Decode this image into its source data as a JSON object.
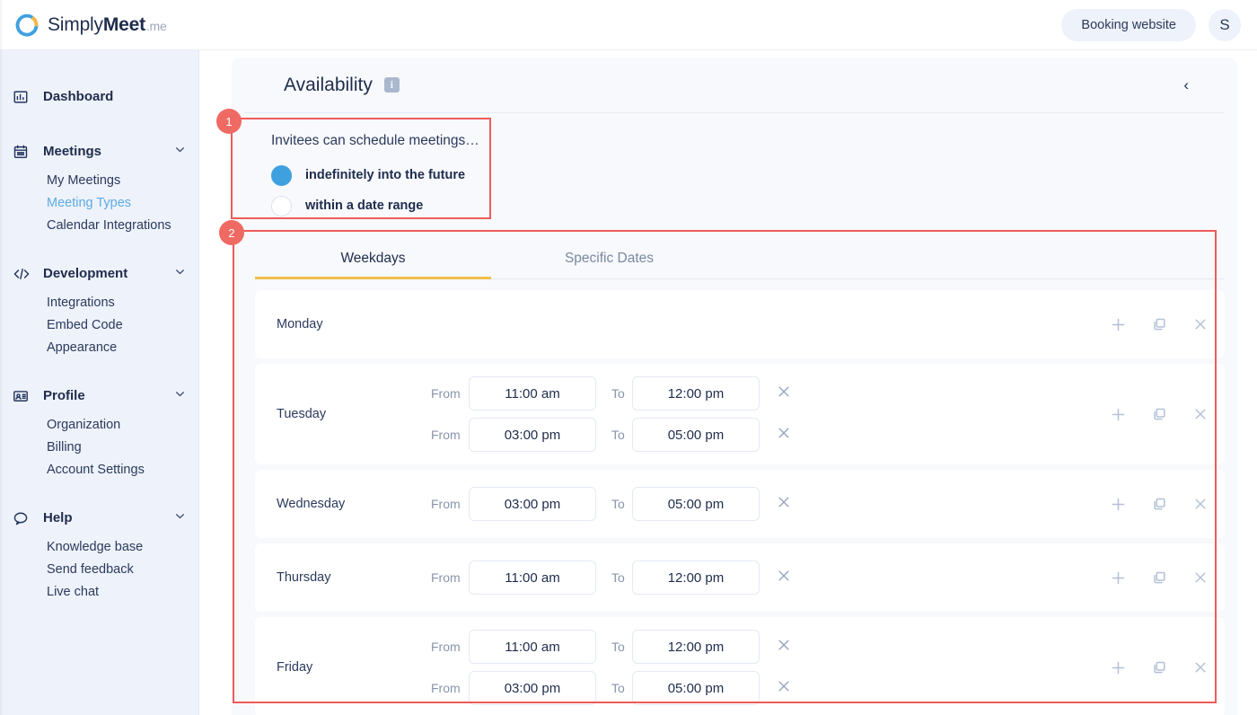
{
  "brand": {
    "name_light": "Simply",
    "name_bold": "Meet",
    "suffix": ".me",
    "logo_icon": "simplymeet-ring-logo"
  },
  "topbar": {
    "booking_button": "Booking website",
    "avatar_initial": "S"
  },
  "sidebar": {
    "groups": [
      {
        "icon": "chart-bar-icon",
        "label": "Dashboard",
        "has_chevron": false,
        "items": []
      },
      {
        "icon": "calendar-icon",
        "label": "Meetings",
        "has_chevron": true,
        "items": [
          {
            "label": "My Meetings",
            "active": false
          },
          {
            "label": "Meeting Types",
            "active": true
          },
          {
            "label": "Calendar Integrations",
            "active": false
          }
        ]
      },
      {
        "icon": "code-icon",
        "label": "Development",
        "has_chevron": true,
        "items": [
          {
            "label": "Integrations",
            "active": false
          },
          {
            "label": "Embed Code",
            "active": false
          },
          {
            "label": "Appearance",
            "active": false
          }
        ]
      },
      {
        "icon": "id-card-icon",
        "label": "Profile",
        "has_chevron": true,
        "items": [
          {
            "label": "Organization",
            "active": false
          },
          {
            "label": "Billing",
            "active": false
          },
          {
            "label": "Account Settings",
            "active": false
          }
        ]
      },
      {
        "icon": "chat-bubble-icon",
        "label": "Help",
        "has_chevron": true,
        "items": [
          {
            "label": "Knowledge base",
            "active": false
          },
          {
            "label": "Send feedback",
            "active": false
          },
          {
            "label": "Live chat",
            "active": false
          }
        ]
      }
    ]
  },
  "availability": {
    "title": "Availability",
    "info_icon": "info-icon",
    "collapse_icon": "chevron-left-icon",
    "schedule_window": {
      "title": "Invitees can schedule meetings…",
      "options": [
        {
          "label": "indefinitely into the future",
          "selected": true
        },
        {
          "label": "within a date range",
          "selected": false
        }
      ]
    },
    "tabs": [
      {
        "label": "Weekdays",
        "active": true
      },
      {
        "label": "Specific Dates",
        "active": false
      }
    ],
    "labels": {
      "from": "From",
      "to": "To"
    },
    "row_action_icons": [
      "plus-icon",
      "copy-icon",
      "close-icon"
    ],
    "days": [
      {
        "name": "Monday",
        "slots": []
      },
      {
        "name": "Tuesday",
        "slots": [
          {
            "from": "11:00 am",
            "to": "12:00 pm"
          },
          {
            "from": "03:00 pm",
            "to": "05:00 pm"
          }
        ]
      },
      {
        "name": "Wednesday",
        "slots": [
          {
            "from": "03:00 pm",
            "to": "05:00 pm"
          }
        ]
      },
      {
        "name": "Thursday",
        "slots": [
          {
            "from": "11:00 am",
            "to": "12:00 pm"
          }
        ]
      },
      {
        "name": "Friday",
        "slots": [
          {
            "from": "11:00 am",
            "to": "12:00 pm"
          },
          {
            "from": "03:00 pm",
            "to": "05:00 pm"
          }
        ]
      }
    ]
  },
  "annotations": [
    {
      "number": "1"
    },
    {
      "number": "2"
    }
  ],
  "colors": {
    "accent_blue": "#3fa0e0",
    "active_link": "#5eaae4",
    "tab_underline": "#f0bf4c",
    "annotation_red": "#ef5b5b",
    "sidebar_bg": "#eef2fb",
    "card_bg": "#f7f9fc",
    "text_dark": "#1f2c4c"
  }
}
